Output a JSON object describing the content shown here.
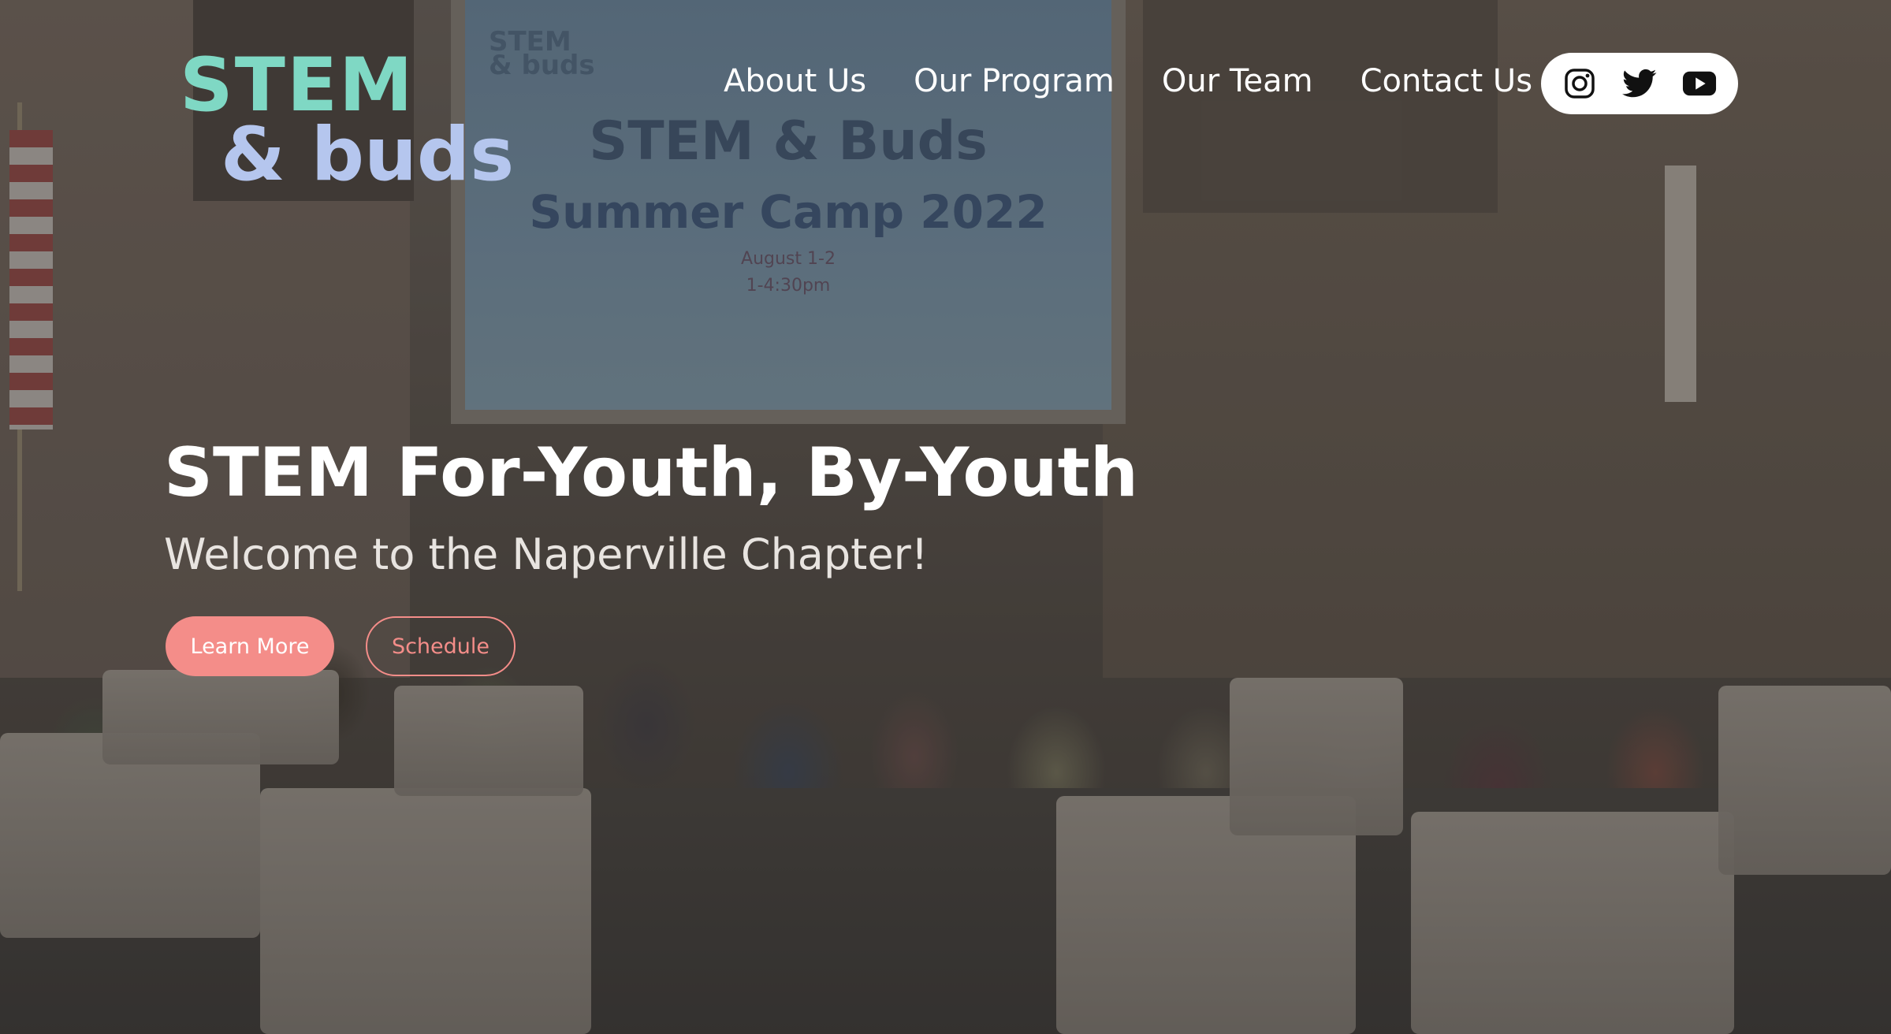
{
  "logo": {
    "line1": "STEM",
    "line2": "& buds"
  },
  "nav": {
    "items": [
      {
        "label": "About Us"
      },
      {
        "label": "Our Program"
      },
      {
        "label": "Our Team"
      },
      {
        "label": "Contact Us"
      }
    ]
  },
  "social": {
    "icons": [
      "instagram-icon",
      "twitter-icon",
      "youtube-icon"
    ]
  },
  "background_photo": {
    "screen_logo": "STEM\n& buds",
    "screen_title": "STEM & Buds",
    "screen_subtitle": "Summer Camp 2022",
    "screen_date": "August 1-2",
    "screen_time": "1-4:30pm"
  },
  "hero": {
    "title": "STEM For-Youth, By-Youth",
    "subtitle": "Welcome to the Naperville Chapter!",
    "primary_button": "Learn More",
    "secondary_button": "Schedule"
  },
  "colors": {
    "accent": "#f48d89",
    "logo_teal": "#7fd8c4",
    "logo_lavender": "#b5c6ee"
  }
}
